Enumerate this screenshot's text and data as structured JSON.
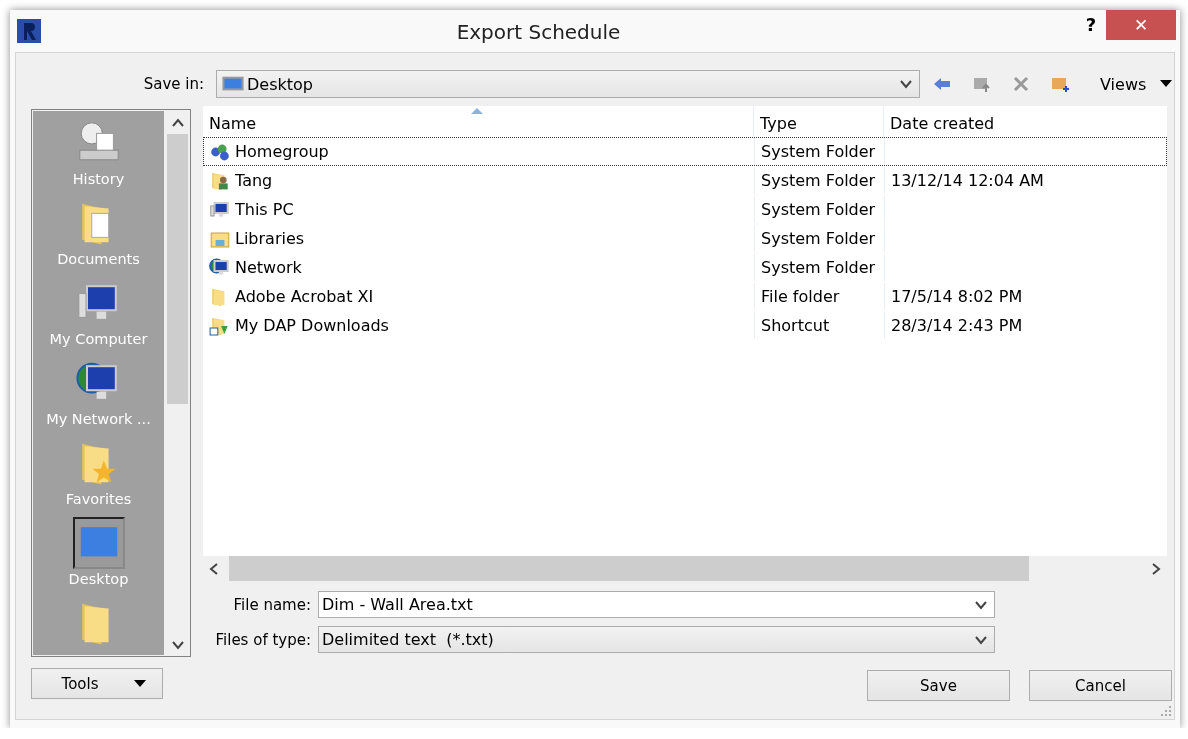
{
  "window": {
    "title": "Export Schedule",
    "buttons": [
      "?",
      "✕"
    ]
  },
  "save_in": {
    "label": "Save in:",
    "value": "Desktop"
  },
  "toolbar": {
    "views": "Views"
  },
  "places": [
    {
      "kind": "history",
      "label": "History",
      "selected": false
    },
    {
      "kind": "documents",
      "label": "Documents",
      "selected": false
    },
    {
      "kind": "computer",
      "label": "My Computer",
      "selected": false
    },
    {
      "kind": "network",
      "label": "My Network ...",
      "selected": false
    },
    {
      "kind": "favorites",
      "label": "Favorites",
      "selected": false
    },
    {
      "kind": "desktop",
      "label": "Desktop",
      "selected": true
    },
    {
      "kind": "folder",
      "selected": false
    }
  ],
  "file_list": {
    "columns": [
      "Name",
      "Type",
      "Date created"
    ],
    "rows": [
      {
        "kind": "homegroup",
        "name": "Homegroup",
        "type": "System Folder",
        "focused": true
      },
      {
        "kind": "user-folder",
        "name": "Tang",
        "type": "System Folder",
        "date": "13/12/14 12:04 AM",
        "focused": false
      },
      {
        "kind": "computer",
        "name": "This PC",
        "type": "System Folder",
        "focused": false
      },
      {
        "kind": "libraries",
        "name": "Libraries",
        "type": "System Folder",
        "focused": false
      },
      {
        "kind": "network",
        "name": "Network",
        "type": "System Folder",
        "focused": false
      },
      {
        "kind": "folder",
        "name": "Adobe Acrobat XI",
        "type": "File folder",
        "date": "17/5/14 8:02 PM",
        "focused": false
      },
      {
        "kind": "shortcut-folder",
        "name": "My DAP Downloads",
        "type": "Shortcut",
        "date": "28/3/14 2:43 PM",
        "focused": false
      }
    ]
  },
  "file_name": {
    "label": "File name:",
    "value": "Dim - Wall Area.txt"
  },
  "file_type": {
    "label": "Files of type:",
    "value": "Delimited text  (*.txt)"
  },
  "buttons": {
    "tools": "Tools",
    "save": "Save",
    "cancel": "Cancel"
  }
}
